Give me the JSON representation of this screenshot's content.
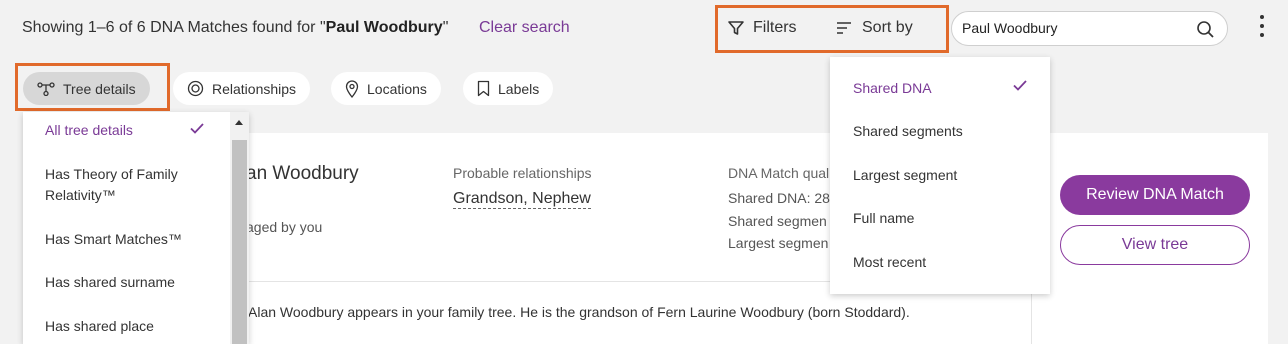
{
  "header": {
    "showing_prefix": "Showing 1–6 of 6 DNA Matches found for \"",
    "search_term": "Paul Woodbury",
    "showing_suffix": "\"",
    "clear_label": "Clear search",
    "filters_label": "Filters",
    "sort_label": "Sort by",
    "search_value": "Paul Woodbury"
  },
  "filter_pills": [
    {
      "label": "Tree details",
      "icon": "tree-icon",
      "active": true
    },
    {
      "label": "Relationships",
      "icon": "target-icon"
    },
    {
      "label": "Locations",
      "icon": "location-pin-icon"
    },
    {
      "label": "Labels",
      "icon": "bookmark-icon"
    }
  ],
  "tree_menu": {
    "items": [
      {
        "label": "All tree details",
        "selected": true
      },
      {
        "label": "Has Theory of Family Relativity™"
      },
      {
        "label": "Has Smart Matches™"
      },
      {
        "label": "Has shared surname"
      },
      {
        "label": "Has shared place"
      }
    ]
  },
  "sort_menu": {
    "items": [
      {
        "label": "Shared DNA",
        "selected": true
      },
      {
        "label": "Shared segments"
      },
      {
        "label": "Largest segment"
      },
      {
        "label": "Full name"
      },
      {
        "label": "Most recent"
      }
    ]
  },
  "match_card": {
    "name": "an Woodbury",
    "managed": "aged by you",
    "probable_label": "Probable relationships",
    "probable_value": "Grandson, Nephew",
    "dna_label": "DNA Match qual",
    "shared_dna": "Shared DNA: 28",
    "shared_segments": "Shared segmen",
    "largest_segment": "Largest segmen",
    "description": "Alan Woodbury appears in your family tree. He is the grandson of Fern Laurine Woodbury (born Stoddard).",
    "review_button": "Review DNA Match",
    "view_tree_button": "View tree"
  },
  "colors": {
    "accent": "#8a3a9e",
    "highlight": "#e16a2b"
  }
}
